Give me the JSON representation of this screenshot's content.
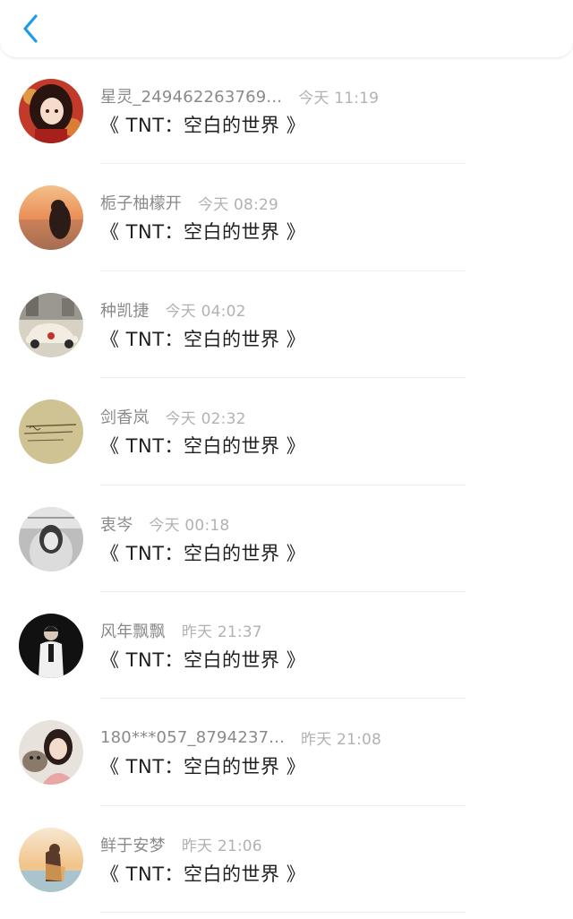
{
  "header": {
    "back_icon": "chevron-left-icon",
    "accent_color": "#1e9be8"
  },
  "list": {
    "items": [
      {
        "name": "星灵_249462263769...",
        "time": "今天 11:19",
        "title": "《 TNT：空白的世界 》",
        "avatar": "girl-red-illustration"
      },
      {
        "name": "栀子柚檬开",
        "time": "今天 08:29",
        "title": "《 TNT：空白的世界 》",
        "avatar": "sunset-silhouette"
      },
      {
        "name": "种凯捷",
        "time": "今天 04:02",
        "title": "《 TNT：空白的世界 》",
        "avatar": "vintage-car"
      },
      {
        "name": "剑香岚",
        "time": "今天 02:32",
        "title": "《 TNT：空白的世界 》",
        "avatar": "handwriting-paper"
      },
      {
        "name": "衷岑",
        "time": "今天 00:18",
        "title": "《 TNT：空白的世界 》",
        "avatar": "bw-portrait"
      },
      {
        "name": "风年飘飘",
        "time": "昨天 21:37",
        "title": "《 TNT：空白的世界 》",
        "avatar": "dark-portrait"
      },
      {
        "name": "180***057_8794237...",
        "time": "昨天 21:08",
        "title": "《 TNT：空白的世界 》",
        "avatar": "girl-with-cat"
      },
      {
        "name": "鲜于安梦",
        "time": "昨天 21:06",
        "title": "《 TNT：空白的世界 》",
        "avatar": "beach-girl"
      }
    ]
  }
}
